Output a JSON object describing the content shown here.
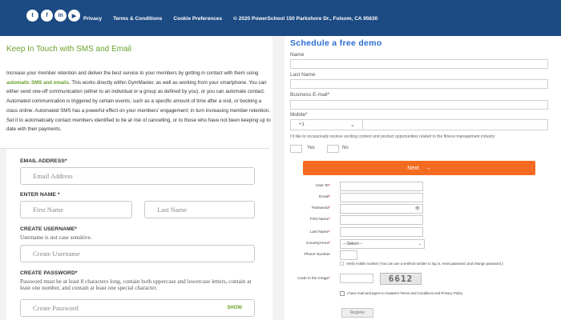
{
  "header": {
    "social": [
      "t",
      "f",
      "in",
      "▶"
    ],
    "links": [
      "Privacy",
      "Terms & Conditions",
      "Cookie Preferences"
    ],
    "copyright": "© 2020 PowerSchool 150 Parkshore Dr., Folsom, CA 95630"
  },
  "intro": {
    "title": "Keep In Touch with SMS and Email",
    "p1": "Increase your member retention and deliver the best service to your members by getting in contact with them using ",
    "highlight": "automatic SMS and emails",
    "p2": ". This works directly within GymMaster, as well as working from your smartphone. You can either send one-off communication (either to an individual or a group as defined by you), or you can automate contact. Automated communication is triggered by certain events, such as a specific amount of time after a visit, or booking a class online. Automated SMS has a powerful effect on your members' engagement; in turn increasing member retention. Set it to automatically contact members identified to be at risk of cancelling, or to those who have not been keeping up to date with their payments."
  },
  "signup": {
    "email_label": "EMAIL ADDRESS*",
    "email_placeholder": "Email Address",
    "name_label": "ENTER NAME *",
    "first_placeholder": "First Name",
    "last_placeholder": "Last Name",
    "username_label": "CREATE USERNAME*",
    "username_note": "Username is not case sensitive.",
    "username_placeholder": "Create Username",
    "password_label": "CREATE PASSWORD*",
    "password_note": "Password must be at least 8 characters long, contain both uppercase and lowercase letters, contain at least one number, and contain at least one special character.",
    "password_placeholder": "Create Password",
    "show_label": "SHOW"
  },
  "demo": {
    "title": "Schedule a free demo",
    "name_label": "Name",
    "lastname_label": "Last Name",
    "email_label": "Business E-mail*",
    "mobile_label": "Mobile*",
    "mobile_code": "+1",
    "consent": "I'd like to occasionally receive exciting content and product opportunities related to the fitness management industry",
    "yes": "Yes",
    "no": "No",
    "next_label": "Next",
    "next_arrow": "→"
  },
  "register": {
    "fields": [
      {
        "label": "User ID"
      },
      {
        "label": "Email"
      },
      {
        "label": "Password"
      },
      {
        "label": "First Name"
      },
      {
        "label": "Last Name"
      }
    ],
    "country_label": "Country/Area",
    "country_value": "---Select---",
    "phone_label": "Phone Number",
    "verify_note": "Verify mobile number (You can use a verified number to log in, reset password, and change password.)",
    "code_label": "Code in the image",
    "captcha": "6612",
    "terms": "I have read and agree to Huawei's Terms and Conditions and Privacy Policy",
    "register_label": "Register"
  },
  "colors": {
    "header_bg": "#1c4a82",
    "accent_green": "#6aa12a",
    "demo_blue": "#2a6dd0",
    "next_orange": "#f26b21"
  }
}
